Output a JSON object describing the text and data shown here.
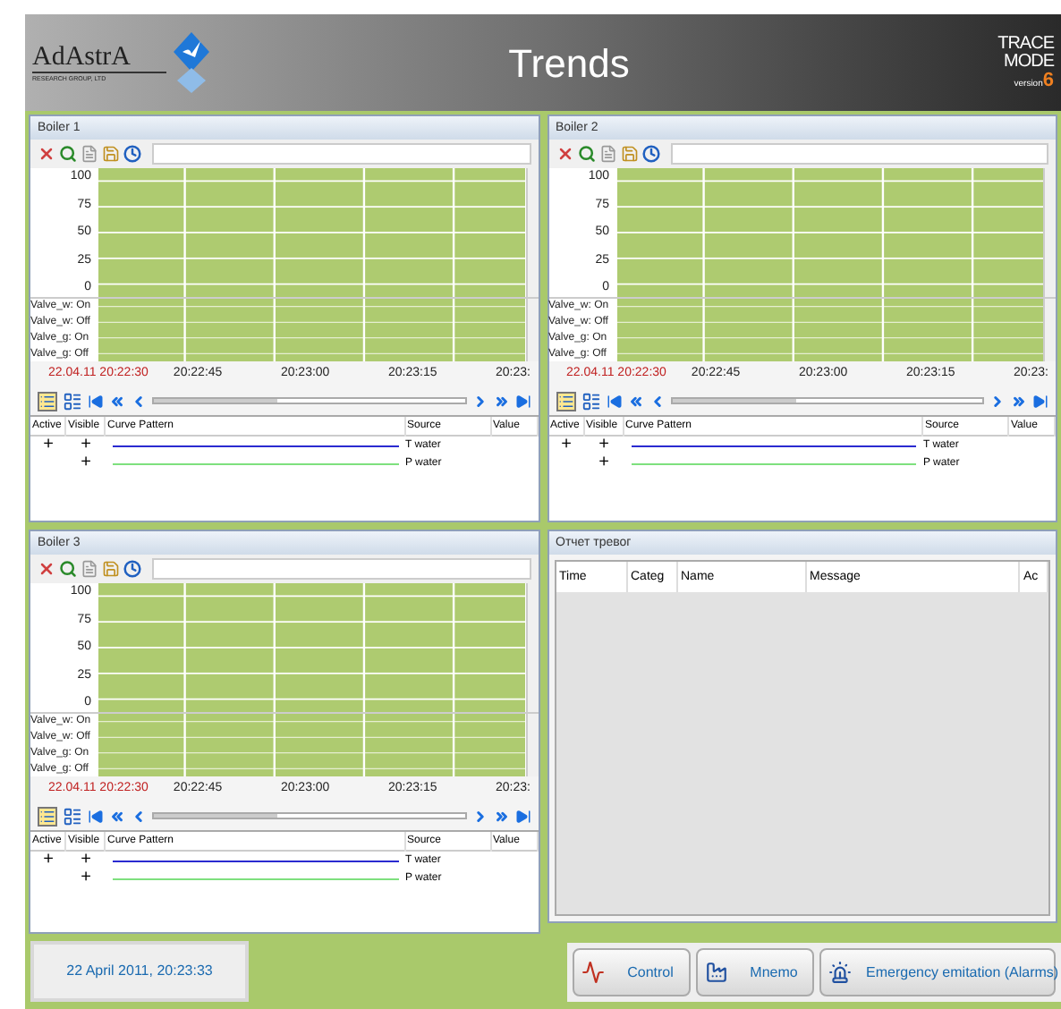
{
  "header": {
    "logo_text": "AdAstrA",
    "logo_subtitle": "RESEARCH GROUP, LTD",
    "title": "Trends",
    "brand_line1": "TRACE",
    "brand_line2": "MODE",
    "brand_version": "version",
    "brand_number": "6"
  },
  "trend_panels": [
    {
      "title": "Boiler 1",
      "yticks": [
        "100",
        "75",
        "50",
        "25",
        "0"
      ],
      "discrete_labels": [
        "Valve_w: On",
        "Valve_w: Off",
        "Valve_g: On",
        "Valve_g: Off"
      ],
      "time_start": "22.04.11 20:22:30",
      "time_labels": [
        "20:22:45",
        "20:23:00",
        "20:23:15",
        "20:23:"
      ],
      "columns": [
        "Active",
        "Visible",
        "Curve Pattern",
        "Source",
        "Value"
      ],
      "rows": [
        {
          "active": "+",
          "visible": "+",
          "color": "#2a2ad0",
          "source": "T water"
        },
        {
          "visible": "+",
          "color": "#7ee07e",
          "source": "P water"
        }
      ]
    },
    {
      "title": "Boiler 2",
      "yticks": [
        "100",
        "75",
        "50",
        "25",
        "0"
      ],
      "discrete_labels": [
        "Valve_w: On",
        "Valve_w: Off",
        "Valve_g: On",
        "Valve_g: Off"
      ],
      "time_start": "22.04.11 20:22:30",
      "time_labels": [
        "20:22:45",
        "20:23:00",
        "20:23:15",
        "20:23:"
      ],
      "columns": [
        "Active",
        "Visible",
        "Curve Pattern",
        "Source",
        "Value"
      ],
      "rows": [
        {
          "active": "+",
          "visible": "+",
          "color": "#2a2ad0",
          "source": "T water"
        },
        {
          "visible": "+",
          "color": "#7ee07e",
          "source": "P water"
        }
      ]
    },
    {
      "title": "Boiler 3",
      "yticks": [
        "100",
        "75",
        "50",
        "25",
        "0"
      ],
      "discrete_labels": [
        "Valve_w: On",
        "Valve_w: Off",
        "Valve_g: On",
        "Valve_g: Off"
      ],
      "time_start": "22.04.11 20:22:30",
      "time_labels": [
        "20:22:45",
        "20:23:00",
        "20:23:15",
        "20:23:"
      ],
      "columns": [
        "Active",
        "Visible",
        "Curve Pattern",
        "Source",
        "Value"
      ],
      "rows": [
        {
          "active": "+",
          "visible": "+",
          "color": "#2a2ad0",
          "source": "T water"
        },
        {
          "visible": "+",
          "color": "#7ee07e",
          "source": "P water"
        }
      ]
    }
  ],
  "alarm_panel": {
    "title": "Отчет тревог",
    "columns": [
      "Time",
      "Categ",
      "Name",
      "Message",
      "Ac"
    ]
  },
  "footer": {
    "datetime": "22 April 2011, 20:23:33",
    "buttons": [
      {
        "label": "Control",
        "kind": "control"
      },
      {
        "label": "Mnemo",
        "kind": "mnemo"
      },
      {
        "label": "Emergency emitation (Alarms)",
        "kind": "alarms"
      }
    ]
  }
}
